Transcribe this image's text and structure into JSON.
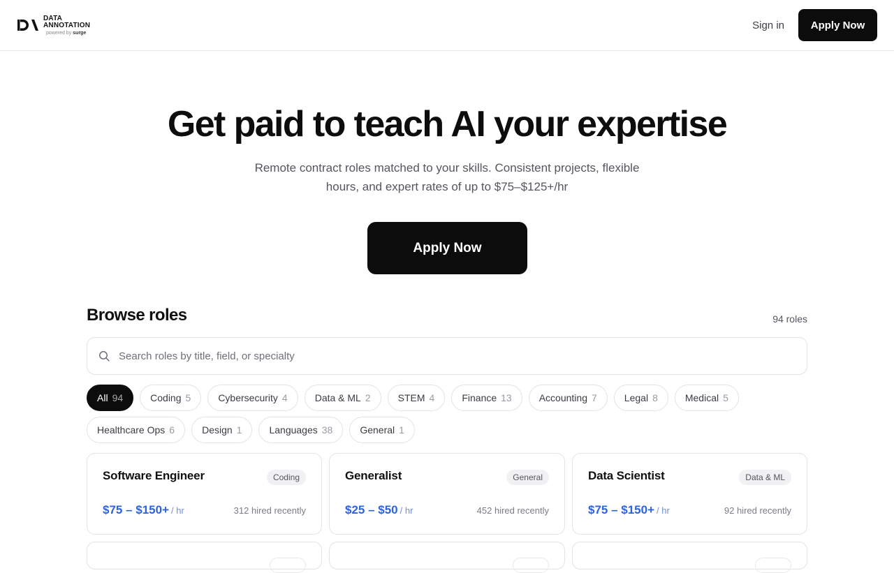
{
  "brand": {
    "line1": "DATA",
    "line2": "ANNOTATION",
    "powered_prefix": "powered by",
    "powered_brand": "surge"
  },
  "nav": {
    "signin": "Sign in",
    "apply": "Apply Now"
  },
  "hero": {
    "title": "Get paid to teach AI your expertise",
    "subtitle": "Remote contract roles matched to your skills. Consistent projects, flexible hours, and expert rates of up to $75–$125+/hr",
    "cta": "Apply Now"
  },
  "browse": {
    "title": "Browse roles",
    "count_text": "94 roles",
    "search_placeholder": "Search roles by title, field, or specialty",
    "filters": [
      {
        "label": "All",
        "count": "94",
        "active": true
      },
      {
        "label": "Coding",
        "count": "5"
      },
      {
        "label": "Cybersecurity",
        "count": "4"
      },
      {
        "label": "Data & ML",
        "count": "2"
      },
      {
        "label": "STEM",
        "count": "4"
      },
      {
        "label": "Finance",
        "count": "13"
      },
      {
        "label": "Accounting",
        "count": "7"
      },
      {
        "label": "Legal",
        "count": "8"
      },
      {
        "label": "Medical",
        "count": "5"
      },
      {
        "label": "Healthcare Ops",
        "count": "6"
      },
      {
        "label": "Design",
        "count": "1"
      },
      {
        "label": "Languages",
        "count": "38"
      },
      {
        "label": "General",
        "count": "1"
      }
    ],
    "roles": [
      {
        "title": "Software Engineer",
        "tag": "Coding",
        "rate": "$75 – $150+",
        "per": "/ hr",
        "hired": "312 hired recently"
      },
      {
        "title": "Generalist",
        "tag": "General",
        "rate": "$25 – $50",
        "per": "/ hr",
        "hired": "452 hired recently"
      },
      {
        "title": "Data Scientist",
        "tag": "Data & ML",
        "rate": "$75 – $150+",
        "per": "/ hr",
        "hired": "92 hired recently"
      }
    ]
  },
  "colors": {
    "accent_blue": "#2b63e0",
    "button_dark": "#0c0c0c"
  }
}
